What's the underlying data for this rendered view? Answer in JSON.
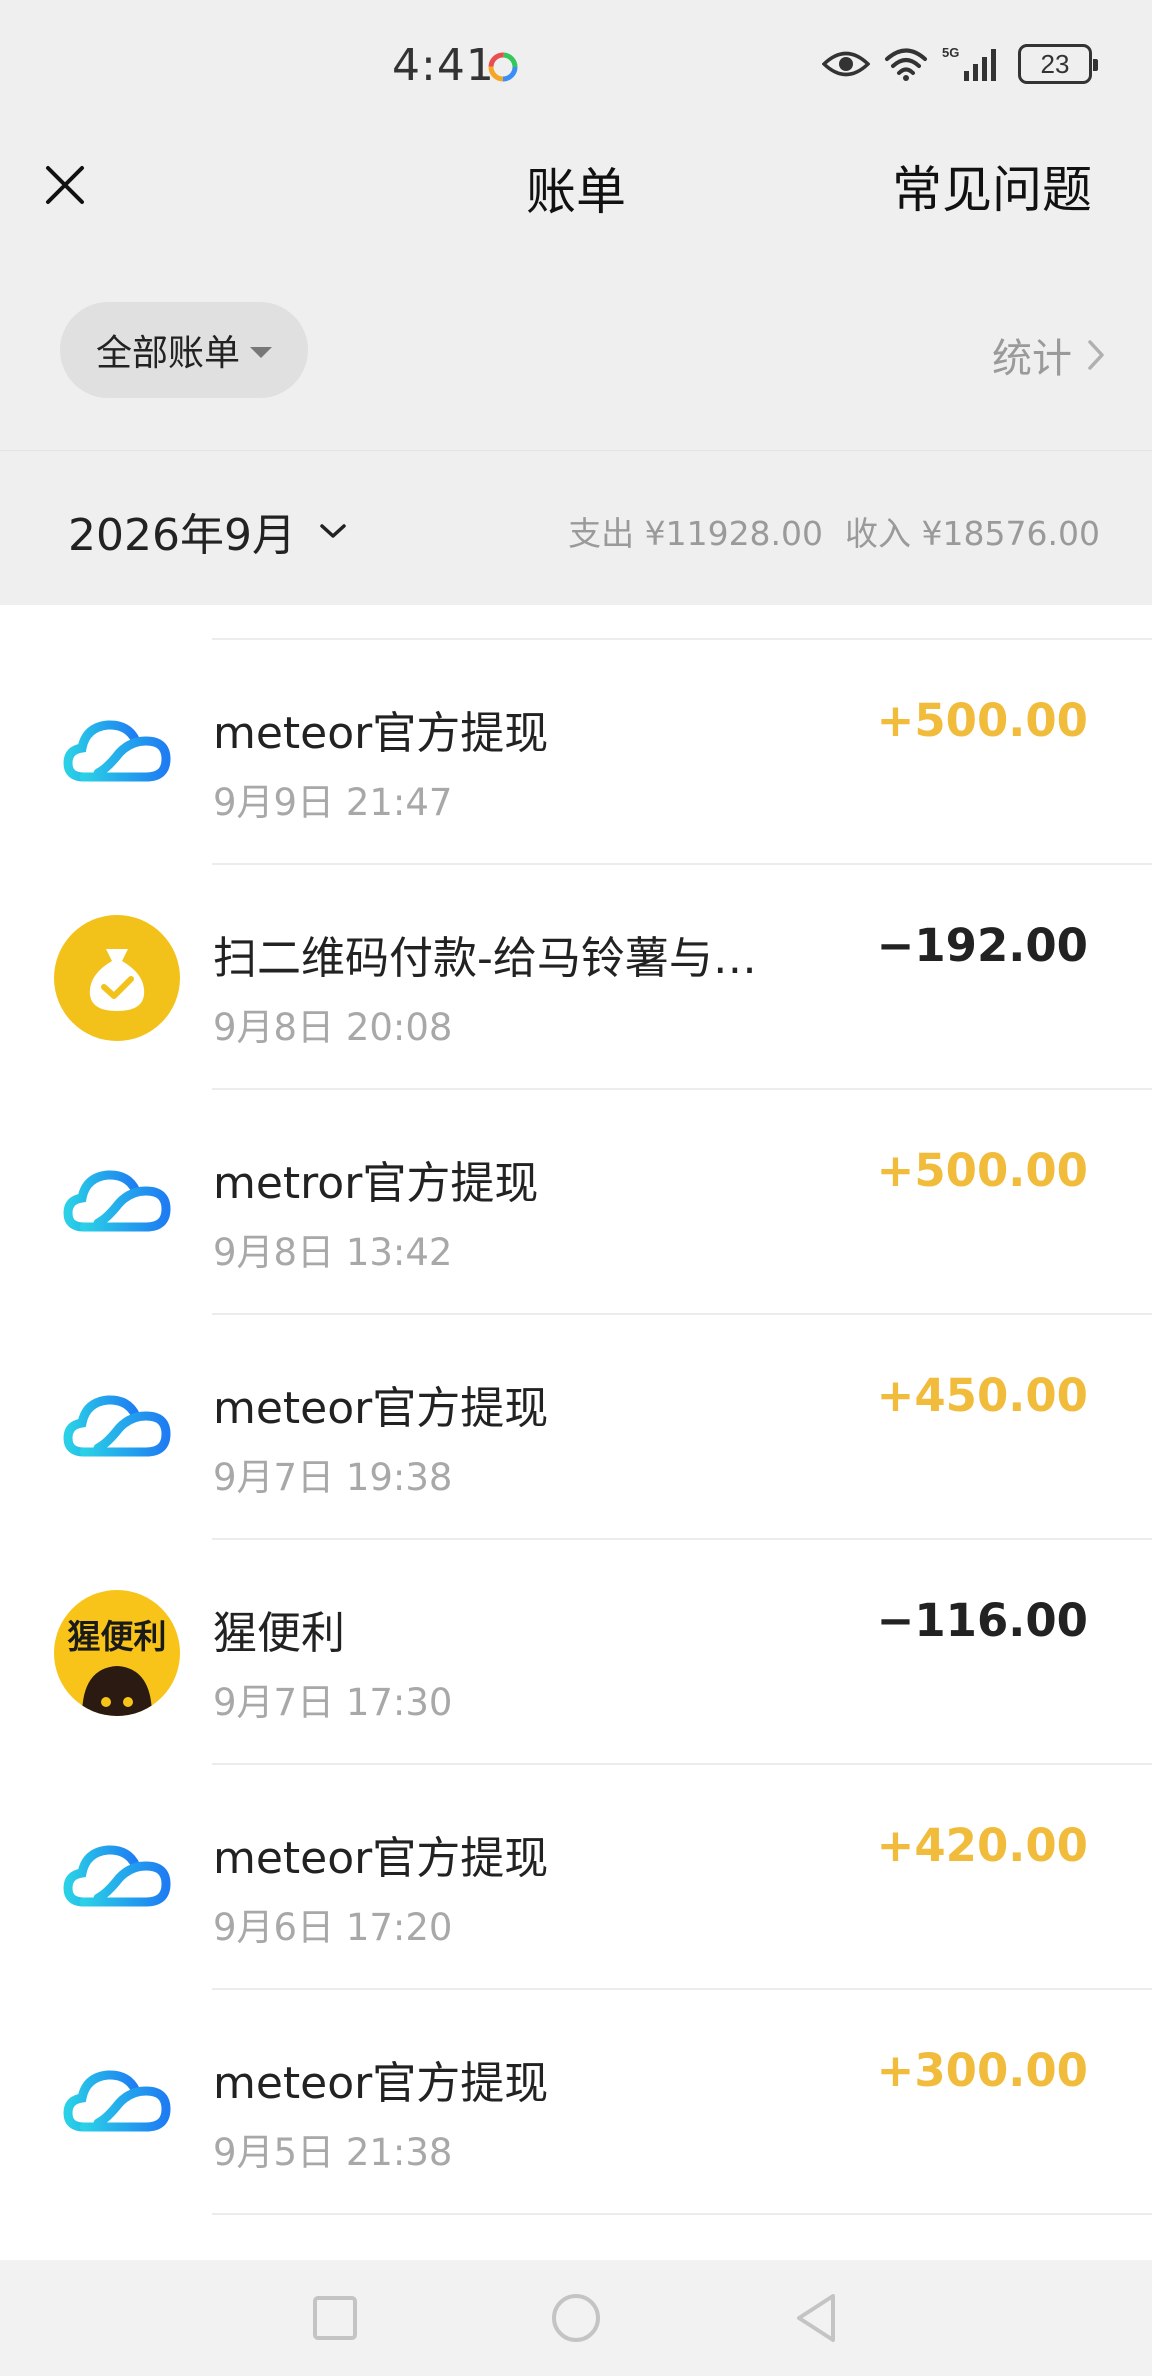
{
  "status_bar": {
    "time": "4:41",
    "battery": "23",
    "network": "5G"
  },
  "header": {
    "title": "账单",
    "faq": "常见问题"
  },
  "filter": {
    "selected": "全部账单",
    "stats": "统计"
  },
  "month_bar": {
    "month": "2026年9月",
    "expense": "支出 ¥11928.00",
    "income": "收入 ¥18576.00"
  },
  "colors": {
    "income": "#f1bc3c",
    "expense": "#222222",
    "background": "#efefef"
  },
  "transactions": [
    {
      "title": "meteor官方提现",
      "time": "9月9日 21:47",
      "amount": "+500.00",
      "kind": "income",
      "icon": "cloud-icon"
    },
    {
      "title": "扫二维码付款-给马铃薯与…",
      "time": "9月8日 20:08",
      "amount": "−192.00",
      "kind": "expense",
      "icon": "money-bag-icon"
    },
    {
      "title": "metror官方提现",
      "time": "9月8日 13:42",
      "amount": "+500.00",
      "kind": "income",
      "icon": "cloud-icon"
    },
    {
      "title": "meteor官方提现",
      "time": "9月7日 19:38",
      "amount": "+450.00",
      "kind": "income",
      "icon": "cloud-icon"
    },
    {
      "title": "猩便利",
      "time": "9月7日 17:30",
      "amount": "−116.00",
      "kind": "expense",
      "icon": "xingbianli-logo",
      "logo_text": "猩便利"
    },
    {
      "title": "meteor官方提现",
      "time": "9月6日 17:20",
      "amount": "+420.00",
      "kind": "income",
      "icon": "cloud-icon"
    },
    {
      "title": "meteor官方提现",
      "time": "9月5日 21:38",
      "amount": "+300.00",
      "kind": "income",
      "icon": "cloud-icon"
    }
  ],
  "nav": {
    "recents": "recents-icon",
    "home": "home-icon",
    "back": "back-icon"
  }
}
